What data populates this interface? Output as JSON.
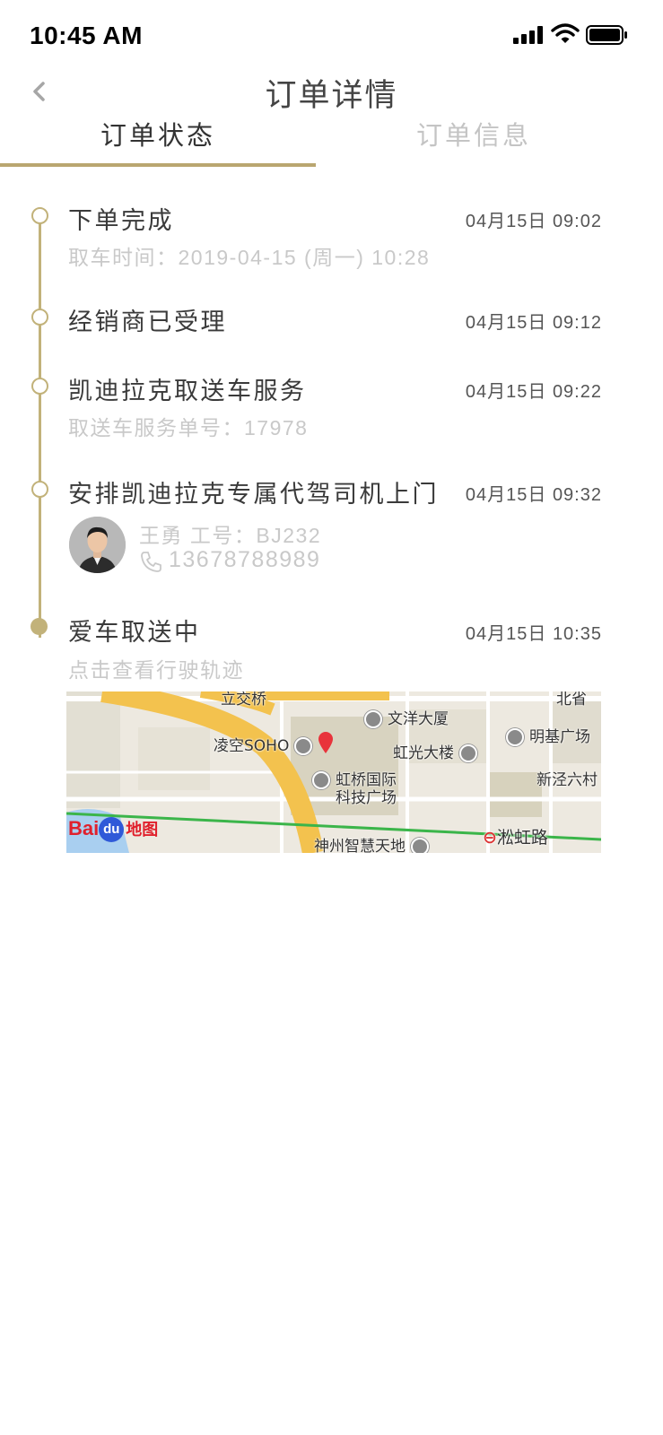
{
  "status_bar": {
    "time": "10:45 AM"
  },
  "nav": {
    "title": "订单详情"
  },
  "tabs": [
    {
      "label": "订单状态",
      "active": true
    },
    {
      "label": "订单信息",
      "active": false
    }
  ],
  "colors": {
    "accent": "#c2b27a",
    "tab_underline": "#b9a670",
    "muted_text": "#c9c9c9"
  },
  "timeline": [
    {
      "title": "下单完成",
      "time": "04月15日 09:02",
      "sub": "取车时间：2019-04-15 (周一) 10:28"
    },
    {
      "title": "经销商已受理",
      "time": "04月15日 09:12"
    },
    {
      "title": "凯迪拉克取送车服务",
      "time": "04月15日 09:22",
      "sub": "取送车服务单号：17978"
    },
    {
      "title": "安排凯迪拉克专属代驾司机上门",
      "time": "04月15日 09:32",
      "driver": {
        "name": "王勇  工号：BJ232",
        "phone": "13678788989"
      }
    },
    {
      "title": "爱车取送中",
      "time": "04月15日 10:35",
      "sub": "点击查看行驶轨迹",
      "current": true
    }
  ],
  "map": {
    "labels": {
      "lijiaoqiao": "立交桥",
      "wenyang": "文洋大厦",
      "north": "北省",
      "lingkong": "凌空SOHO",
      "hongguang": "虹光大楼",
      "mingji": "明基广场",
      "hongqiao1": "虹桥国际",
      "hongqiao2": "科技广场",
      "xinjing": "新泾六村",
      "shenzhou": "神州智慧天地",
      "songhong": "淞虹路"
    },
    "logo_text": "Bai",
    "logo_du": "du",
    "logo_suffix": "地图"
  }
}
